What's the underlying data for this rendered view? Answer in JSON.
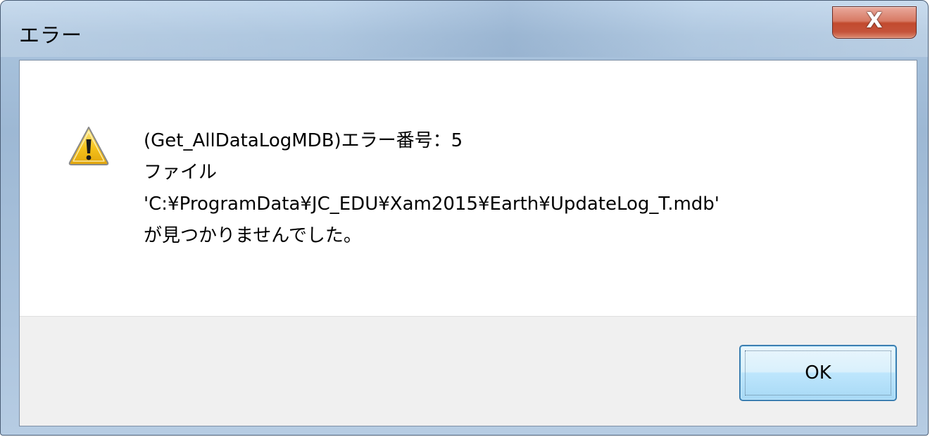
{
  "window": {
    "title": "エラー",
    "close_label": "X"
  },
  "message": {
    "lines": [
      "(Get_AllDataLogMDB)エラー番号：5",
      "ファイル",
      "'C:¥ProgramData¥JC_EDU¥Xam2015¥Earth¥UpdateLog_T.mdb'",
      "が見つかりませんでした。"
    ],
    "icon": "warning-icon"
  },
  "buttons": {
    "ok_label": "OK"
  },
  "colors": {
    "close_button": "#c24a2e",
    "ok_border": "#3c7fb1",
    "warning_fill": "#f5c21b"
  }
}
